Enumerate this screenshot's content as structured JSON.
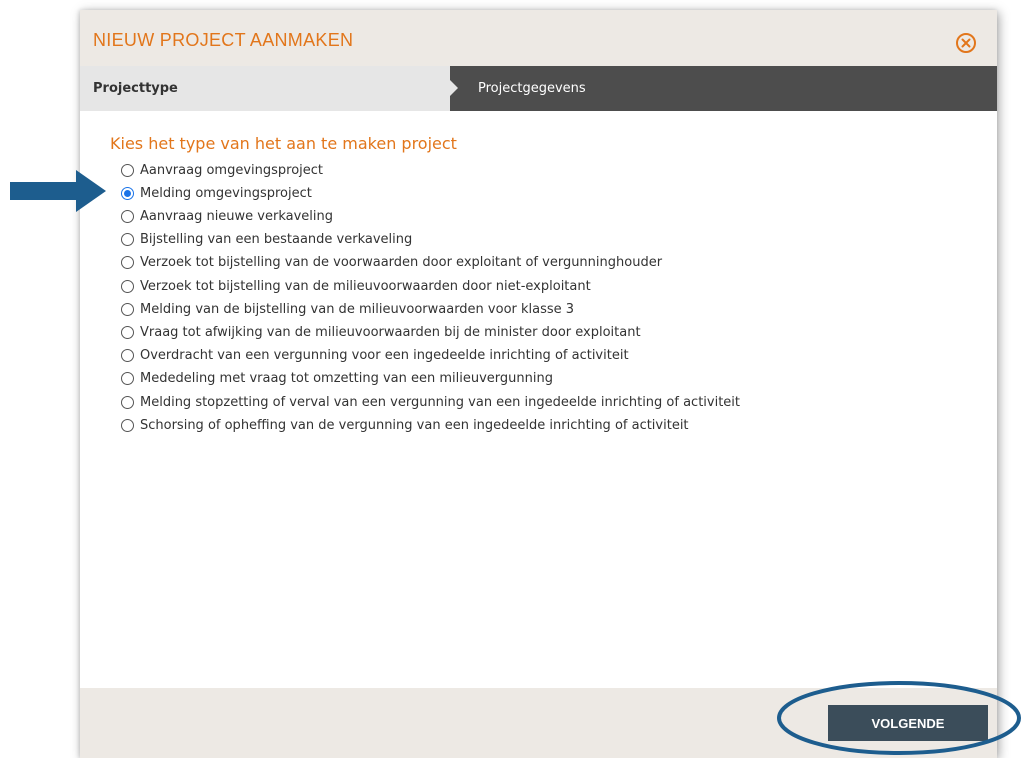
{
  "modal": {
    "title": "NIEUW PROJECT AANMAKEN",
    "close_icon": "circle-x-icon"
  },
  "steps": [
    {
      "label": "Projecttype",
      "state": "active"
    },
    {
      "label": "Projectgegevens",
      "state": "inactive"
    }
  ],
  "section": {
    "title": "Kies het type van het aan te maken project"
  },
  "options": [
    {
      "label": "Aanvraag omgevingsproject",
      "checked": false
    },
    {
      "label": "Melding omgevingsproject",
      "checked": true
    },
    {
      "label": "Aanvraag nieuwe verkaveling",
      "checked": false
    },
    {
      "label": "Bijstelling van een bestaande verkaveling",
      "checked": false
    },
    {
      "label": "Verzoek tot bijstelling van de voorwaarden door exploitant of vergunninghouder",
      "checked": false
    },
    {
      "label": "Verzoek tot bijstelling van de milieuvoorwaarden door niet-exploitant",
      "checked": false
    },
    {
      "label": "Melding van de bijstelling van de milieuvoorwaarden voor klasse 3",
      "checked": false
    },
    {
      "label": "Vraag tot afwijking van de milieuvoorwaarden bij de minister door exploitant",
      "checked": false
    },
    {
      "label": "Overdracht van een vergunning voor een ingedeelde inrichting of activiteit",
      "checked": false
    },
    {
      "label": "Mededeling met vraag tot omzetting van een milieuvergunning",
      "checked": false
    },
    {
      "label": "Melding stopzetting of verval van een vergunning van een ingedeelde inrichting of activiteit",
      "checked": false
    },
    {
      "label": "Schorsing of opheffing van de vergunning van een ingedeelde inrichting of activiteit",
      "checked": false
    }
  ],
  "footer": {
    "next_label": "VOLGENDE"
  },
  "annotations": {
    "arrow_icon": "right-arrow-icon",
    "ellipse_icon": "highlight-ellipse-icon"
  },
  "colors": {
    "accent": "#e2761b",
    "header_bg": "#ede9e4",
    "step_bar": "#4d4d4d",
    "step_active": "#e6e6e6",
    "button": "#3b4d5a",
    "annotation_blue": "#1d5d8e",
    "radio_checked": "#1a73e8"
  }
}
